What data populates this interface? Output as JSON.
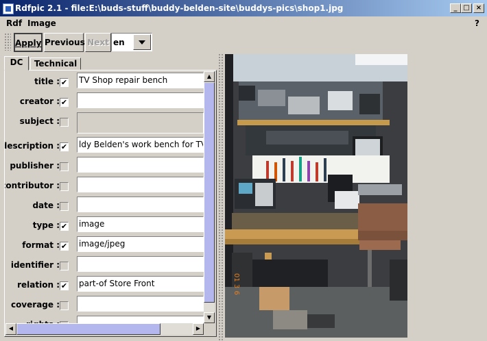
{
  "window": {
    "title": "Rdfpic 2.1 - file:E:\\buds-stuff\\buddy-belden-site\\buddys-pics\\shop1.jpg",
    "controls": {
      "minimize": "_",
      "maximize": "□",
      "close": "×"
    }
  },
  "menubar": {
    "items": [
      "Rdf",
      "Image"
    ],
    "help": "?"
  },
  "toolbar": {
    "apply_label": "Apply",
    "previous_label": "Previous",
    "next_label": "Next",
    "language": "en"
  },
  "tabs": [
    "DC",
    "Technical"
  ],
  "fields": [
    {
      "label": "title :",
      "checked": true,
      "value": "TV Shop repair bench",
      "enabled": true
    },
    {
      "label": "creator :",
      "checked": true,
      "value": "",
      "enabled": true
    },
    {
      "label": "subject :",
      "checked": false,
      "value": "",
      "enabled": false
    },
    {
      "label": "description :",
      "checked": true,
      "value": "ldy Belden's work bench for TV/VC",
      "enabled": true
    },
    {
      "label": "publisher :",
      "checked": false,
      "value": "",
      "enabled": true
    },
    {
      "label": "contributor :",
      "checked": false,
      "value": "",
      "enabled": true
    },
    {
      "label": "date :",
      "checked": false,
      "value": "",
      "enabled": true
    },
    {
      "label": "type :",
      "checked": true,
      "value": "image",
      "enabled": true
    },
    {
      "label": "format :",
      "checked": true,
      "value": "image/jpeg",
      "enabled": true
    },
    {
      "label": "identifier :",
      "checked": false,
      "value": "",
      "enabled": true
    },
    {
      "label": "relation :",
      "checked": true,
      "value": "part-of Store Front",
      "enabled": true
    },
    {
      "label": "coverage :",
      "checked": false,
      "value": "",
      "enabled": true
    },
    {
      "label": "rights :",
      "checked": false,
      "value": "",
      "enabled": true
    }
  ],
  "photo": {
    "date_stamp": "01 3 6"
  },
  "colors": {
    "title_start": "#0a246a",
    "title_end": "#a6caf0",
    "scroll_thumb": "#b3b7ee",
    "face": "#d4d0c8"
  }
}
